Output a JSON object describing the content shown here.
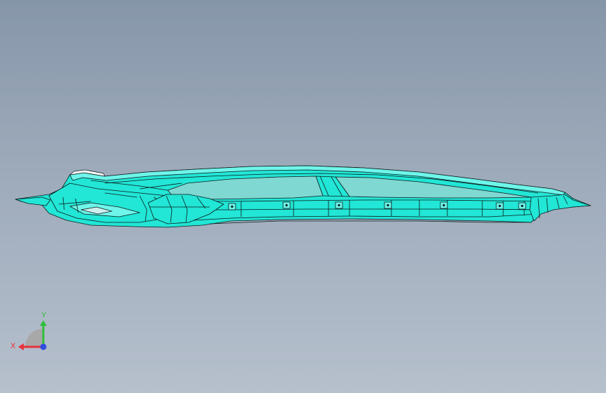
{
  "viewport": {
    "background_top": "#8696a9",
    "background_bottom": "#b6c0cd"
  },
  "model": {
    "name": "part-model",
    "fill_color": "#22e6d6",
    "highlight_color": "#6ff5ea",
    "edge_color": "#0a1a1a"
  },
  "triad": {
    "x_label": "X",
    "y_label": "Y",
    "x_color": "#e8323a",
    "y_color": "#2fbf3a",
    "z_color": "#2f4fe0"
  }
}
